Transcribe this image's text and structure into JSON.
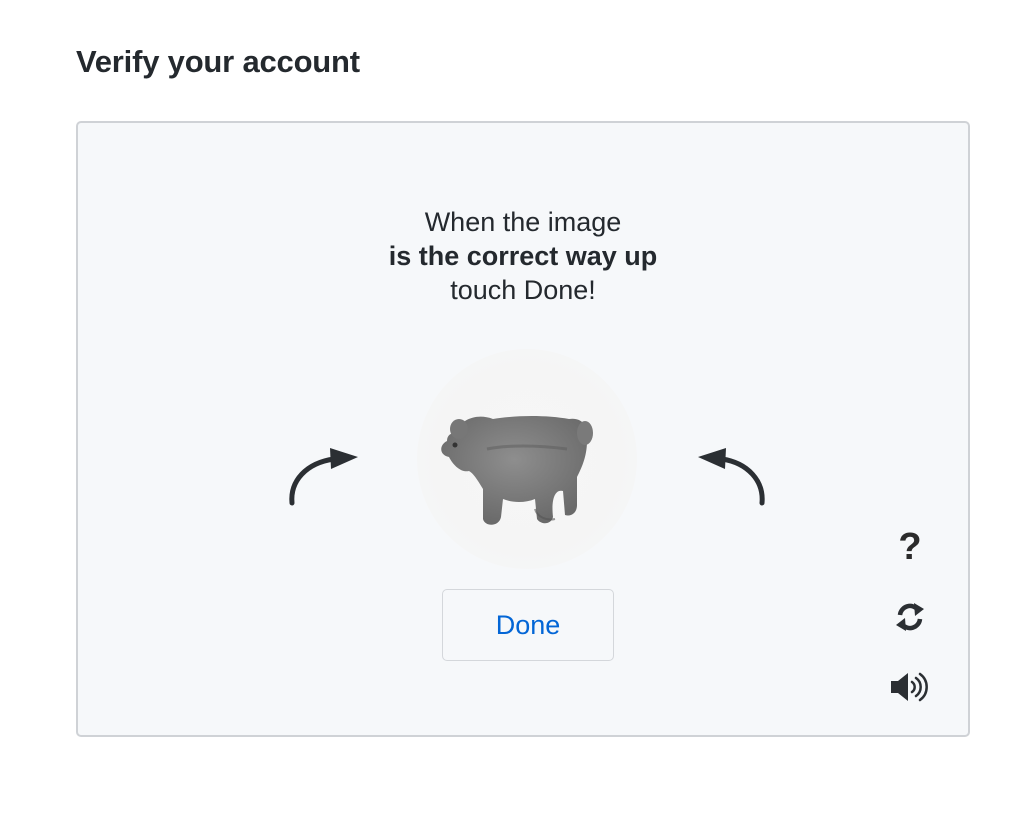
{
  "page": {
    "title": "Verify your account"
  },
  "challenge": {
    "instruction_line1": "When the image",
    "instruction_line2": "is the correct way up",
    "instruction_line3": "touch Done!",
    "done_label": "Done",
    "help_label": "?",
    "icons": {
      "rotate_left": "rotate-counterclockwise-arrow-icon",
      "rotate_right": "rotate-clockwise-arrow-icon",
      "refresh": "refresh-icon",
      "audio": "speaker-icon"
    }
  },
  "colors": {
    "link_blue": "#0366d6",
    "frame_background": "#f6f8fa",
    "frame_border": "#cfd2d6",
    "text_dark": "#24292e"
  }
}
